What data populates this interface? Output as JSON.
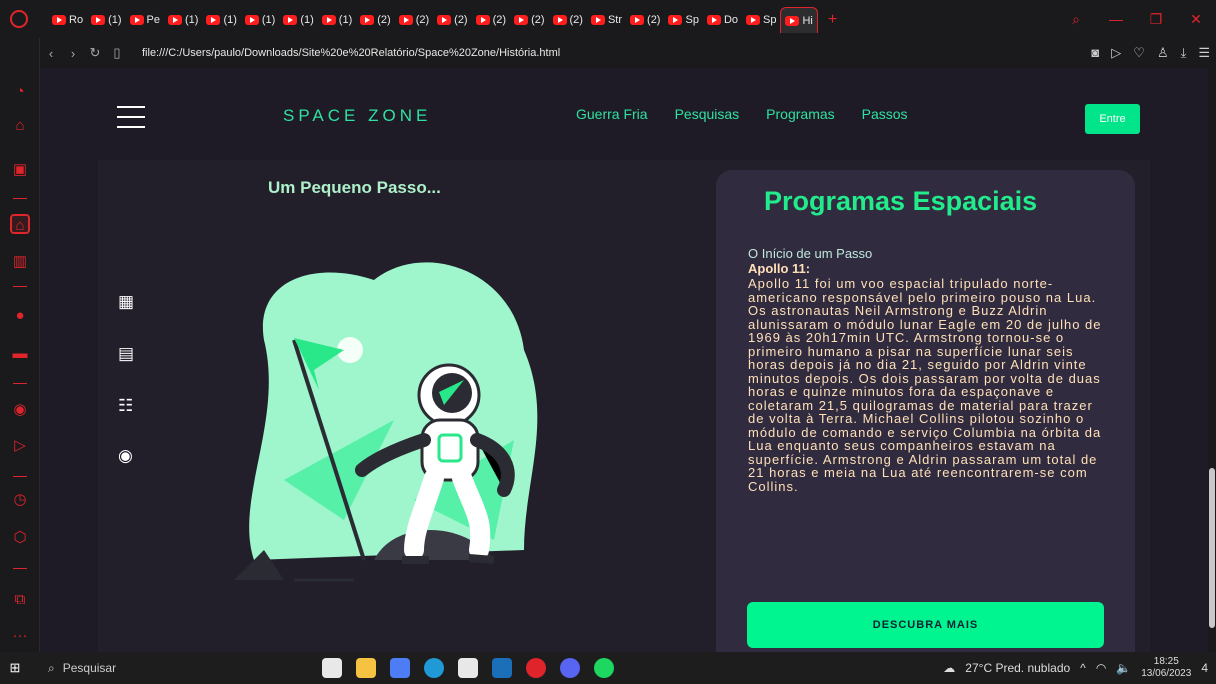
{
  "browser": {
    "tabs": [
      "Ro",
      "(1)",
      "Pe",
      "(1)",
      "(1)",
      "(1)",
      "(1)",
      "(1)",
      "(2)",
      "(2)",
      "(2)",
      "(2)",
      "(2)",
      "(2)",
      "Str",
      "(2)",
      "Sp",
      "Do",
      "Sp",
      "Hi"
    ],
    "active_tab": "Hi",
    "new_tab": "+",
    "url": "file:///C:/Users/paulo/Downloads/Site%20e%20Relatório/Space%20Zone/História.html",
    "accent": "#e0242b"
  },
  "header": {
    "logo": "SPACE ZONE",
    "menu": [
      "Guerra Fria",
      "Pesquisas",
      "Programas",
      "Passos"
    ],
    "login_label": "Entre"
  },
  "left": {
    "title": "Um Pequeno Passo..."
  },
  "card": {
    "title": "Programas Espaciais",
    "subtitle": "O Início de um Passo",
    "heading": "Apollo 11:",
    "body": "Apollo 11 foi um voo espacial tripulado norte-americano responsável pelo primeiro pouso na Lua. Os astronautas Neil Armstrong e Buzz Aldrin alunissaram o módulo lunar Eagle em 20 de julho de 1969 às 20h17min UTC. Armstrong tornou-se o primeiro humano a pisar na superfície lunar seis horas depois já no dia 21, seguido por Aldrin vinte minutos depois. Os dois passaram por volta de duas horas e quinze minutos fora da espaçonave e coletaram 21,5 quilogramas de material para trazer de volta à Terra. Michael Collins pilotou sozinho o módulo de comando e serviço Columbia na órbita da Lua enquanto seus companheiros estavam na superfície. Armstrong e Aldrin passaram um total de 21 horas e meia na Lua até reencontrarem-se com Collins.",
    "cta_label": "DESCUBRA MAIS"
  },
  "colors": {
    "brand": "#2fe1a0",
    "cta": "#00f48f",
    "card_bg": "#302b3e",
    "body_text": "#ffe0b8"
  },
  "taskbar": {
    "search_label": "Pesquisar",
    "weather": "27°C Pred. nublado",
    "time": "18:25",
    "date": "13/06/2023",
    "notifications": "4"
  }
}
